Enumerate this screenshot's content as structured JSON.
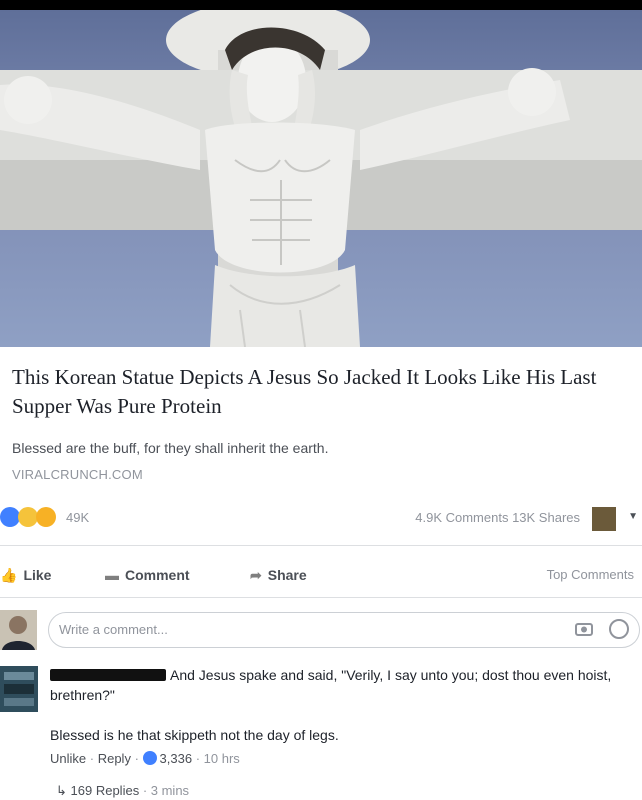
{
  "article": {
    "headline": "This Korean Statue Depicts A Jesus So Jacked It Looks Like His Last Supper Was Pure Protein",
    "description": "Blessed are the buff, for they shall inherit the earth.",
    "source": "VIRALCRUNCH.COM"
  },
  "stats": {
    "reactions_count": "49K",
    "comments_shares": "4.9K Comments  13K Shares"
  },
  "actions": {
    "like": "Like",
    "comment": "Comment",
    "share": "Share",
    "top_comments": "Top Comments"
  },
  "composer": {
    "placeholder": "Write a comment..."
  },
  "comment": {
    "text": "And Jesus spake and said, \"Verily, I say unto you; dost thou even hoist, brethren?\"",
    "reply_preview": "Blessed is he that skippeth not the day of legs.",
    "unlike": "Unlike",
    "reply": "Reply",
    "like_count": "3,336",
    "time": "10 hrs",
    "replies": "169 Replies",
    "replies_time": "3 mins"
  },
  "colors": {
    "like_blue": "#4080ff",
    "text_dark": "#1d2129",
    "text_gray": "#90949c"
  }
}
